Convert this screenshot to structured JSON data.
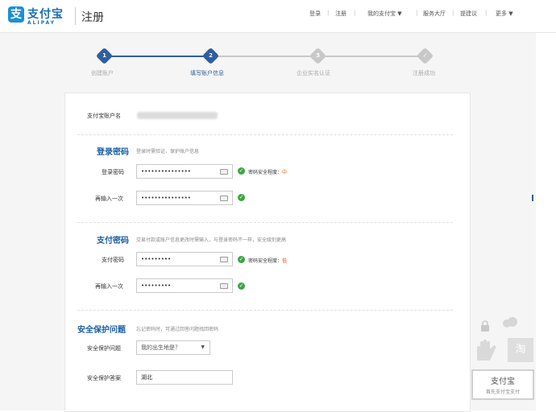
{
  "header": {
    "logo_glyph": "支",
    "logo_cn": "支付宝",
    "logo_en": "ALIPAY",
    "page_title": "注册",
    "nav": [
      {
        "label": "登录"
      },
      {
        "label": "注册"
      },
      {
        "label": "我的支付宝 ▼"
      },
      {
        "label": "服务大厅"
      },
      {
        "label": "提建议"
      },
      {
        "label": "更多 ▼"
      }
    ]
  },
  "steps": [
    {
      "num": "1",
      "label": "创建账户",
      "state": "done"
    },
    {
      "num": "2",
      "label": "填写账户信息",
      "state": "current"
    },
    {
      "num": "3",
      "label": "企业实名认证",
      "state": "pending"
    },
    {
      "num": "✓",
      "label": "注册成功",
      "state": "pending"
    }
  ],
  "colors": {
    "active": "#2f5e9e",
    "inactive": "#c8c8c8",
    "ok": "#3ba640",
    "medium": "#e8621a",
    "low": "#e8421a"
  },
  "form": {
    "account_label": "支付宝账户名",
    "login": {
      "title": "登录密码",
      "hint": "登录时需验证，保护账户信息",
      "password_label": "登录密码",
      "password_value": "•••••••••••••••",
      "confirm_label": "再输入一次",
      "confirm_value": "•••••••••••••••",
      "strength_text": "密码安全程度：",
      "strength_level": "中"
    },
    "pay": {
      "title": "支付密码",
      "hint": "交易付款或账户信息更改时需输入，与登录密码不一样，安全级别更高",
      "password_label": "支付密码",
      "password_value": "•••••••••",
      "confirm_label": "再输入一次",
      "confirm_value": "•••••••••",
      "strength_text": "密码安全程度：",
      "strength_level": "低"
    },
    "security": {
      "title": "安全保护问题",
      "hint": "忘记密码时，可通过回答问题找回密码",
      "question_label": "安全保护问题",
      "question_value": "我的出生地是？",
      "answer_label": "安全保护答案",
      "answer_value": "湖北"
    }
  },
  "promo": {
    "tao": "淘",
    "brand": "支付宝",
    "caption": "首先支付宝支付"
  }
}
